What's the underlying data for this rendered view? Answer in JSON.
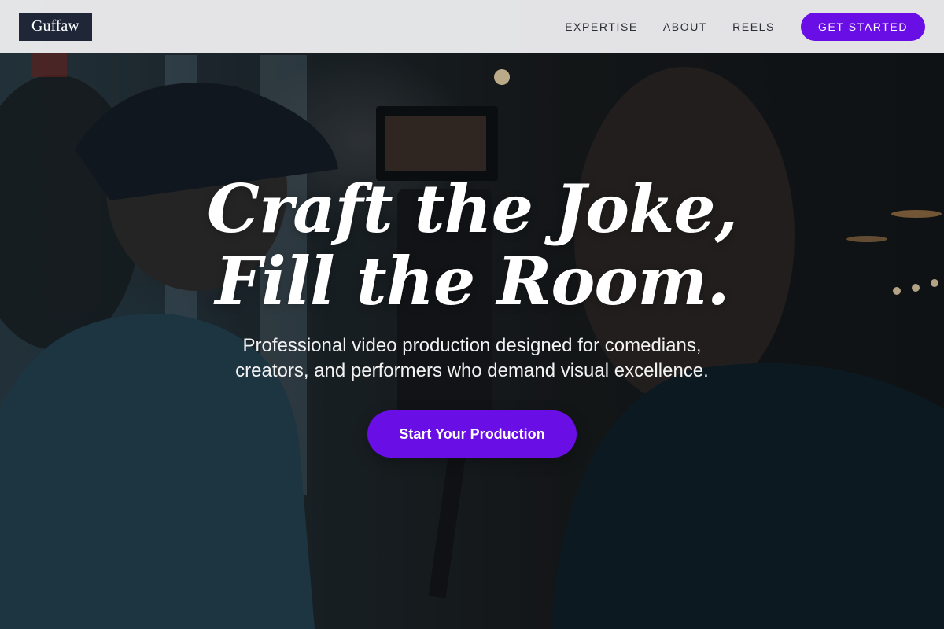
{
  "brand": {
    "logo_text": "Guffaw"
  },
  "nav": {
    "links": [
      {
        "label": "EXPERTISE"
      },
      {
        "label": "ABOUT"
      },
      {
        "label": "REELS"
      }
    ],
    "cta_label": "GET STARTED"
  },
  "hero": {
    "title_line1": "Craft the Joke,",
    "title_line2": "Fill the Room.",
    "subtitle_line1": "Professional video production designed for comedians,",
    "subtitle_line2": "creators, and performers who demand visual excellence.",
    "cta_label": "Start Your Production",
    "background_description_icon": "video-production-photo"
  },
  "colors": {
    "accent": "#6a0ee6",
    "logo_bg": "#1e2638",
    "header_bg": "#ececee"
  }
}
